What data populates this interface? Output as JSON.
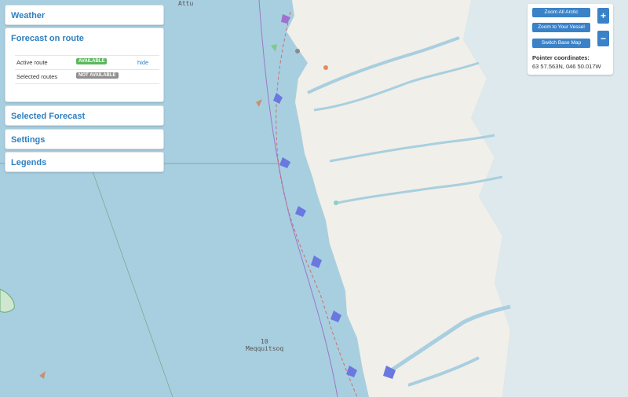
{
  "panels": {
    "weather": "Weather",
    "forecast_on_route": "Forecast on route",
    "selected_forecast": "Selected Forecast",
    "settings": "Settings",
    "legends": "Legends"
  },
  "routes": {
    "active": {
      "label": "Active route",
      "status": "AVAILABLE",
      "action": "hide"
    },
    "selected": {
      "label": "Selected routes",
      "status": "NOT AVAILABLE"
    }
  },
  "map_controls": {
    "zoom_all": "Zoom All Arctic",
    "zoom_vessel": "Zoom to Your Vessel",
    "switch_base": "Switch Base Map",
    "zoom_in": "+",
    "zoom_out": "−",
    "pointer_title": "Pointer coordinates:",
    "pointer_value": "63 57.563N, 046 50.017W"
  },
  "map_labels": {
    "place_top": "Attu",
    "place_bottom_number": "10",
    "place_bottom": "Meqquitsoq"
  },
  "colors": {
    "sea": "#a8cfe0",
    "land": "#f1efe9",
    "ice": "#dde9ec",
    "accent": "#2f7fc1",
    "available": "#5cb85c",
    "not_available": "#8f8f8f"
  }
}
